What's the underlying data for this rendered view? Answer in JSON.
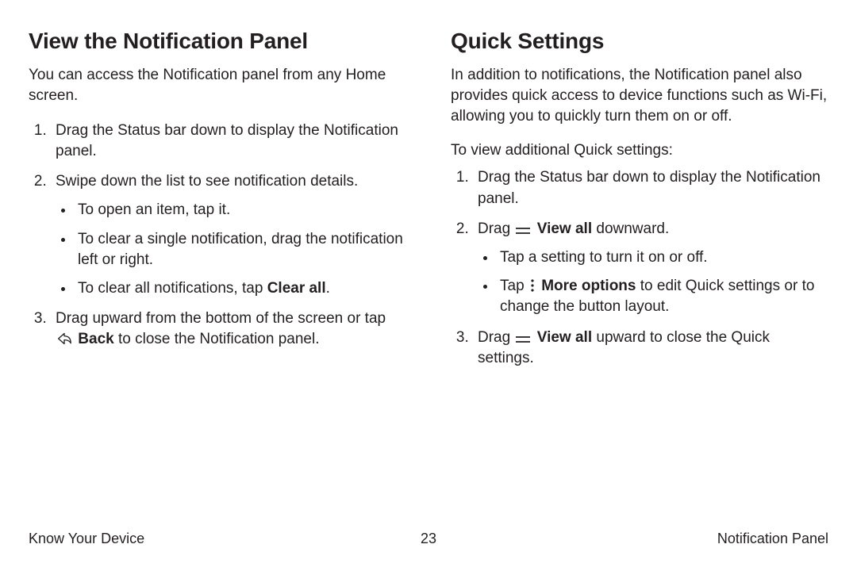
{
  "left": {
    "heading": "View the Notification Panel",
    "intro": "You can access the Notification panel from any Home screen.",
    "steps": {
      "s1": "Drag the Status bar down to display the Notification panel.",
      "s2": "Swipe down the list to see notification details.",
      "s2b1": "To open an item, tap it.",
      "s2b2": "To clear a single notification, drag the notification left or right.",
      "s2b3_pre": "To clear all notifications, tap ",
      "s2b3_bold": "Clear all",
      "s2b3_post": ".",
      "s3_pre": "Drag upward from the bottom of the screen or tap ",
      "s3_icon": "back-icon",
      "s3_bold": " Back",
      "s3_post": " to close the Notification panel."
    }
  },
  "right": {
    "heading": "Quick Settings",
    "intro": "In addition to notifications, the Notification panel also provides quick access to device functions such as Wi-Fi, allowing you to quickly turn them on or off.",
    "lead": "To view additional Quick settings:",
    "steps": {
      "s1": "Drag the Status bar down to display the Notification panel.",
      "s2_pre": "Drag ",
      "s2_icon": "view-all-icon",
      "s2_bold": " View all",
      "s2_post": " downward.",
      "s2b1": "Tap a setting to turn it on or off.",
      "s2b2_pre": "Tap ",
      "s2b2_icon": "more-options-icon",
      "s2b2_bold": " More options",
      "s2b2_post": " to edit Quick settings or to change the button layout.",
      "s3_pre": "Drag ",
      "s3_icon": "view-all-icon",
      "s3_bold": " View all",
      "s3_post": " upward to close the Quick settings."
    }
  },
  "footer": {
    "left": "Know Your Device",
    "center": "23",
    "right": "Notification Panel"
  }
}
